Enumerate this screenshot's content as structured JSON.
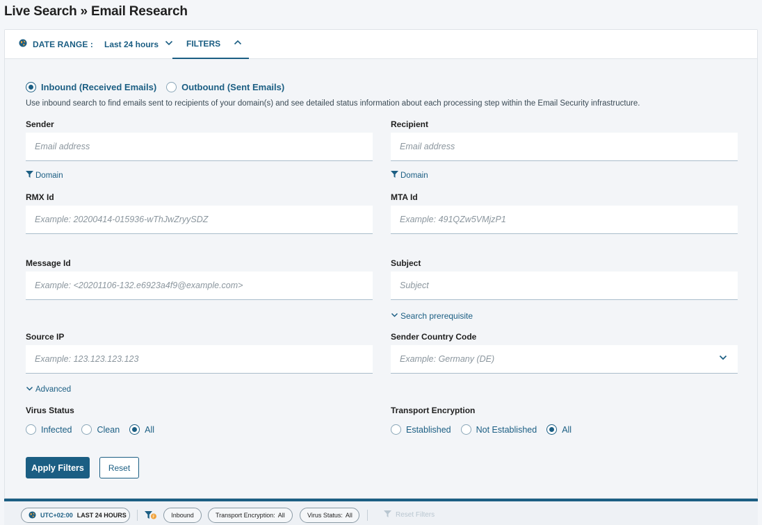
{
  "page": {
    "title": "Live Search » Email Research"
  },
  "topbar": {
    "date_range_label": "DATE RANGE :",
    "date_range_value": "Last 24 hours",
    "filters_tab": "FILTERS"
  },
  "direction": {
    "inbound": "Inbound (Received Emails)",
    "outbound": "Outbound (Sent Emails)",
    "selected": "inbound",
    "description": "Use inbound search to find emails sent to recipients of your domain(s) and see detailed status information about each processing step within the Email Security infrastructure."
  },
  "fields": {
    "sender": {
      "label": "Sender",
      "placeholder": "Email address",
      "domain_link": "Domain"
    },
    "recipient": {
      "label": "Recipient",
      "placeholder": "Email address",
      "domain_link": "Domain"
    },
    "rmx_id": {
      "label": "RMX Id",
      "placeholder": "Example: 20200414-015936-wThJwZryySDZ"
    },
    "mta_id": {
      "label": "MTA Id",
      "placeholder": "Example: 491QZw5VMjzP1"
    },
    "message_id": {
      "label": "Message Id",
      "placeholder": "Example: <20201106-132.e6923a4f9@example.com>"
    },
    "subject": {
      "label": "Subject",
      "placeholder": "Subject",
      "prereq_link": "Search prerequisite"
    },
    "source_ip": {
      "label": "Source IP",
      "placeholder": "Example: 123.123.123.123"
    },
    "sender_country": {
      "label": "Sender Country Code",
      "placeholder": "Example: Germany (DE)"
    }
  },
  "advanced_link": "Advanced",
  "virus_status": {
    "label": "Virus Status",
    "options": [
      "Infected",
      "Clean",
      "All"
    ],
    "selected": "All"
  },
  "transport_encryption": {
    "label": "Transport Encryption",
    "options": [
      "Established",
      "Not Established",
      "All"
    ],
    "selected": "All"
  },
  "buttons": {
    "apply": "Apply Filters",
    "reset": "Reset"
  },
  "statusbar": {
    "timezone": "UTC+02:00",
    "range": "LAST 24 HOURS",
    "direction_chip": "Inbound",
    "transport_label": "Transport Encryption:",
    "transport_value": "All",
    "virus_label": "Virus Status:",
    "virus_value": "All",
    "reset_filters": "Reset Filters"
  },
  "colors": {
    "accent": "#1b5e83",
    "background": "#f4f6f9"
  },
  "icons": {
    "date_range": "globe-icon",
    "date_dropdown": "chevron-down-icon",
    "filters_toggle": "chevron-up-icon",
    "domain": "filter-icon",
    "expand": "chevron-down-icon",
    "statusbar_filter": "filter-icon"
  }
}
